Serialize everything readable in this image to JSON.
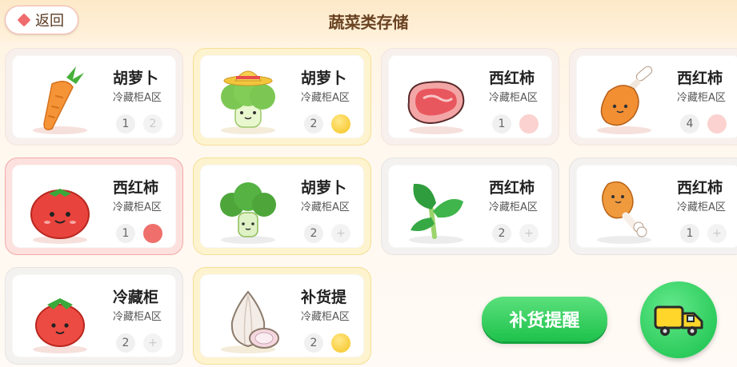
{
  "header": {
    "back_label": "返回",
    "title": "蔬菜类存储"
  },
  "cards": [
    {
      "name": "胡萝卜",
      "location": "冷藏柜A区",
      "count": "1",
      "badge_text": "2",
      "icon": "carrot-icon",
      "variant": "default",
      "badge": "gray"
    },
    {
      "name": "胡萝卜",
      "location": "冷藏柜A区",
      "count": "2",
      "badge_text": "",
      "icon": "broccoli-with-hat-icon",
      "variant": "yellow",
      "badge": "yellow"
    },
    {
      "name": "西红柿",
      "location": "冷藏柜A区",
      "count": "1",
      "badge_text": "",
      "icon": "meat-steak-icon",
      "variant": "default",
      "badge": "pink"
    },
    {
      "name": "西红柿",
      "location": "冷藏柜A区",
      "count": "4",
      "badge_text": "",
      "icon": "chicken-leg-icon",
      "variant": "default",
      "badge": "pink"
    },
    {
      "name": "西红柿",
      "location": "冷藏柜A区",
      "count": "1",
      "badge_text": "",
      "icon": "tomato-icon",
      "variant": "red",
      "badge": "red"
    },
    {
      "name": "胡萝卜",
      "location": "冷藏柜A区",
      "count": "2",
      "badge_text": "+",
      "icon": "broccoli-icon",
      "variant": "yellow",
      "badge": "gray"
    },
    {
      "name": "西红柿",
      "location": "冷藏柜A区",
      "count": "2",
      "badge_text": "+",
      "icon": "leafy-greens-icon",
      "variant": "gray",
      "badge": "gray"
    },
    {
      "name": "西红柿",
      "location": "冷藏柜A区",
      "count": "1",
      "badge_text": "+",
      "icon": "chicken-leg-icon",
      "variant": "gray",
      "badge": "gray"
    },
    {
      "name": "冷藏柜",
      "location": "冷藏柜A区",
      "count": "2",
      "badge_text": "+",
      "icon": "tomato-icon",
      "variant": "gray",
      "badge": "gray"
    },
    {
      "name": "补货提",
      "location": "冷藏柜A区",
      "count": "2",
      "badge_text": "",
      "icon": "garlic-onion-icon",
      "variant": "yellow",
      "badge": "yellow"
    }
  ],
  "actions": {
    "remind_label": "补货提醒",
    "truck_icon": "delivery-truck-icon"
  }
}
